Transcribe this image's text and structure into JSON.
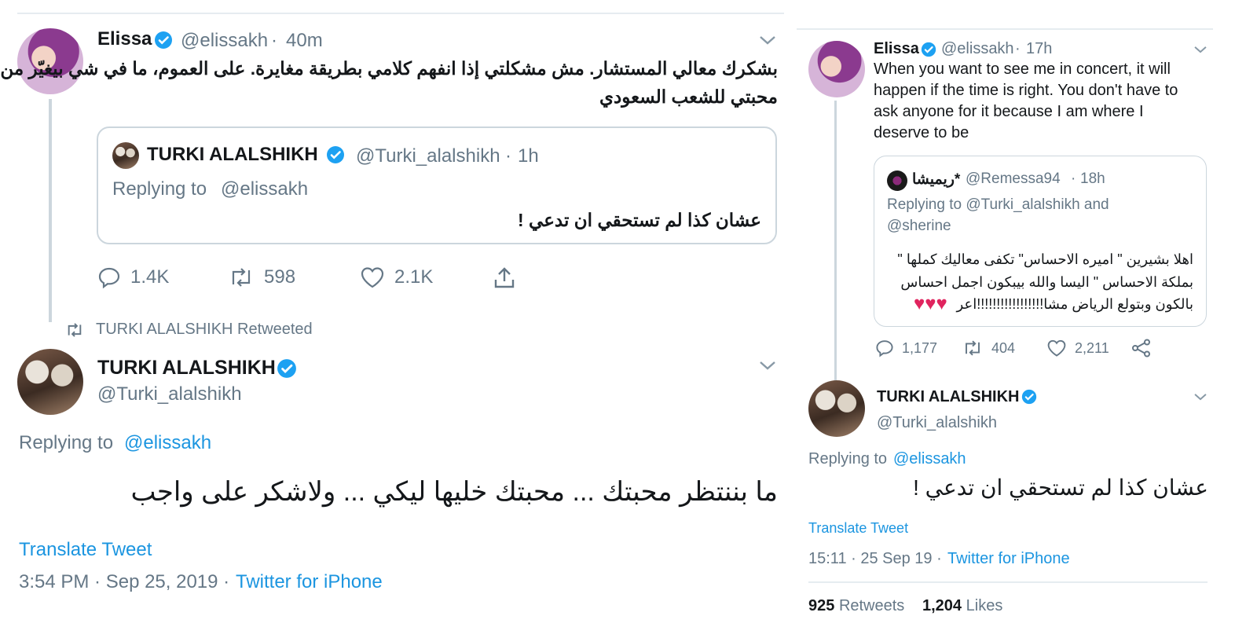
{
  "left": {
    "tweet1": {
      "name": "Elissa",
      "handle": "@elissakh",
      "time": "40m",
      "text_line1": "بشكرك معالي المستشار. مش مشكلتي إذا انفهم كلامي بطريقة مغايرة. على العموم، ما في شي بيغيّر من",
      "text_line2": "محبتي للشعب السعودي",
      "quote": {
        "name": "TURKI ALALSHIKH",
        "handle": "@Turki_alalshikh",
        "time": "1h",
        "replying_prefix": "Replying to",
        "replying_to": "@elissakh",
        "text": "عشان كذا لم تستحقي ان تدعي !"
      },
      "actions": {
        "replies": "1.4K",
        "retweets": "598",
        "likes": "2.1K"
      }
    },
    "retweet_label": "TURKI ALALSHIKH Retweeted",
    "tweet2": {
      "name": "TURKI ALALSHIKH",
      "handle": "@Turki_alalshikh",
      "replying_prefix": "Replying to",
      "replying_to": "@elissakh",
      "text": "ما بننتظر محبتك ... محبتك خليها ليكي ... ولاشكر على واجب",
      "translate": "Translate Tweet",
      "time": "3:54 PM · Sep 25, 2019 ·",
      "source": "Twitter for iPhone"
    }
  },
  "right": {
    "tweet1": {
      "name": "Elissa",
      "handle": "@elissakh",
      "time": "17h",
      "text_line1": "When you want to see me in concert, it will",
      "text_line2": "happen if the time is right. You don't have to",
      "text_line3": "ask anyone for it because I am where I",
      "text_line4": "deserve to be",
      "quote": {
        "name": "ريميشا*",
        "handle": "@Remessa94",
        "time": "18h",
        "replying_line1": "Replying to @Turki_alalshikh and",
        "replying_line2": "@sherine",
        "text_line1": "اهلا بشيرين \" اميره الاحساس\"  تكفى معاليك كملها \"",
        "text_line2": "بملكة الاحساس \" اليسا والله بيبكون اجمل احساس",
        "text_line3": "بالكون وبتولع الرياض مشا!!!!!!!!!!!!!!!!!اعر",
        "hearts": "♥♥♥"
      },
      "actions": {
        "replies": "1,177",
        "retweets": "404",
        "likes": "2,211"
      }
    },
    "tweet2": {
      "name": "TURKI ALALSHIKH",
      "handle": "@Turki_alalshikh",
      "replying_prefix": "Replying to",
      "replying_to": "@elissakh",
      "text": "عشان كذا لم تستحقي ان تدعي !",
      "translate": "Translate Tweet",
      "time": "15:11 · 25 Sep 19 ·",
      "source": "Twitter for iPhone",
      "retweets_count": "925",
      "retweets_label": "Retweets",
      "likes_count": "1,204",
      "likes_label": "Likes"
    }
  },
  "colors": {
    "link": "#1b95e0",
    "verified": "#1da1f2",
    "gray": "#657786",
    "border": "#ccd6dd",
    "heart": "#e0245e"
  },
  "icons": [
    "verified-badge-icon",
    "chevron-down-icon",
    "reply-icon",
    "retweet-icon",
    "like-icon",
    "share-icon"
  ]
}
